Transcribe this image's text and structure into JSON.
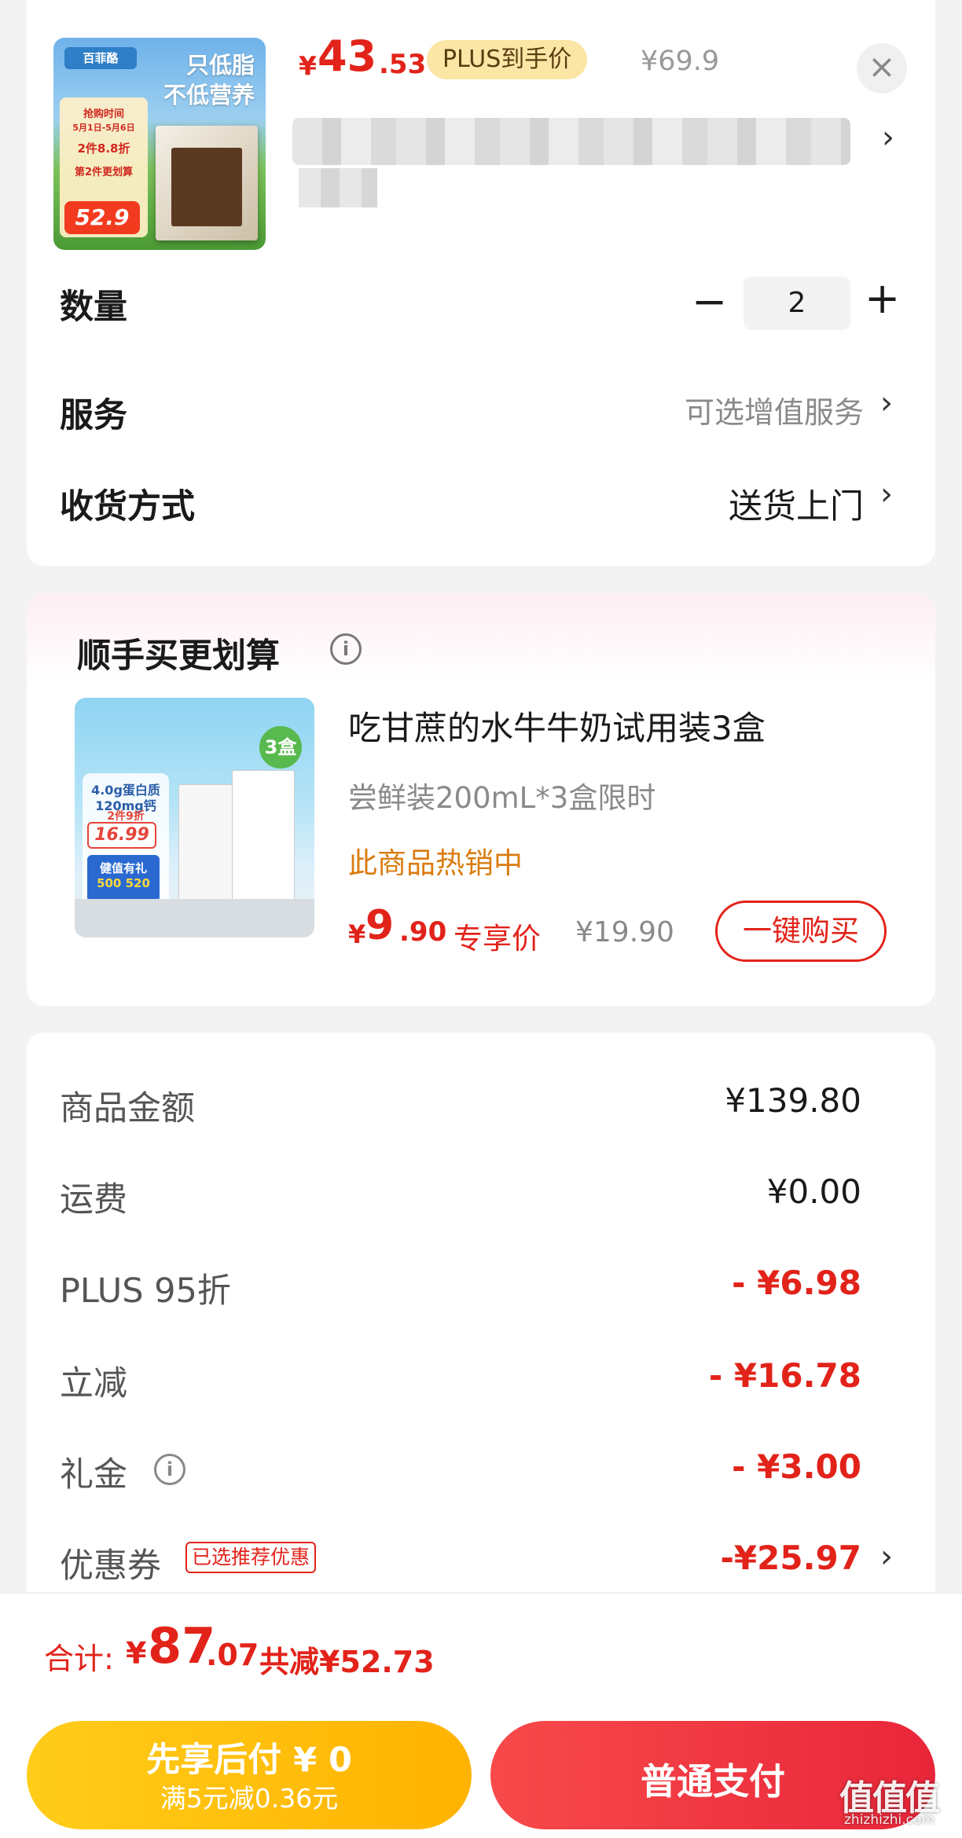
{
  "header": {
    "thumb": {
      "brand": "百菲酪",
      "slogan_line1": "只低脂",
      "slogan_line2": "不低营养",
      "promo_line1": "抢购时间",
      "promo_line2": "5月1日-5月6日",
      "promo_line3": "2件8.8折",
      "promo_line4": "第2件更划算",
      "promo_price": "52.9"
    },
    "price_yen": "¥",
    "price_int": "43",
    "price_dec": ".53",
    "plus_label": "PLUS到手价",
    "original_price": "¥69.9",
    "close_icon": "×",
    "chevron_icon": "›"
  },
  "options": {
    "quantity_label": "数量",
    "minus": "−",
    "quantity": "2",
    "plus": "+",
    "service_label": "服务",
    "service_value": "可选增值服务",
    "delivery_label": "收货方式",
    "delivery_value": "送货上门",
    "chevron": "›"
  },
  "recommend": {
    "title": "顺手买更划算",
    "info_icon": "i",
    "image": {
      "badge": "3盒",
      "line1": "4.0g蛋白质",
      "line2": "120mg钙",
      "line3": "2件9折",
      "price": "16.99",
      "gift_line1": "健值有礼",
      "gift_line2": "500 520"
    },
    "product_name": "吃甘蔗的水牛牛奶试用装3盒",
    "spec": "尝鲜装200mL*3盒限时",
    "hot_text": "此商品热销中",
    "price_yen": "¥",
    "price_int": "9",
    "price_dec": ".90",
    "exclusive_label": "专享价",
    "original_price": "¥19.90",
    "buy_button": "一键购买"
  },
  "amounts": {
    "goods_label": "商品金额",
    "goods_value": "¥139.80",
    "shipping_label": "运费",
    "shipping_value": "¥0.00",
    "plus_label": "PLUS 95折",
    "plus_value": "- ¥6.98",
    "instant_label": "立减",
    "instant_value": "- ¥16.78",
    "gift_label": "礼金",
    "gift_value": "- ¥3.00",
    "coupon_label": "优惠券",
    "coupon_tag": "已选推荐优惠",
    "coupon_value": "-¥25.97",
    "chevron": "›"
  },
  "footer": {
    "total_label": "合计:",
    "total_yen": "¥",
    "total_int": "87",
    "total_dec": ".07",
    "total_save": "共减¥52.73",
    "pay_later_main": "先享后付 ¥ 0",
    "pay_later_sub": "满5元减0.36元",
    "pay_normal": "普通支付",
    "watermark": "值值值",
    "watermark_sub": "zhizhizhi.com"
  },
  "colors": {
    "accent_red": "#e2231a",
    "plus_gold": "#fbe6a6",
    "pay_later_yellow": "#ffb300",
    "pay_normal_red": "#e8263a",
    "hot_orange": "#d97c10"
  }
}
